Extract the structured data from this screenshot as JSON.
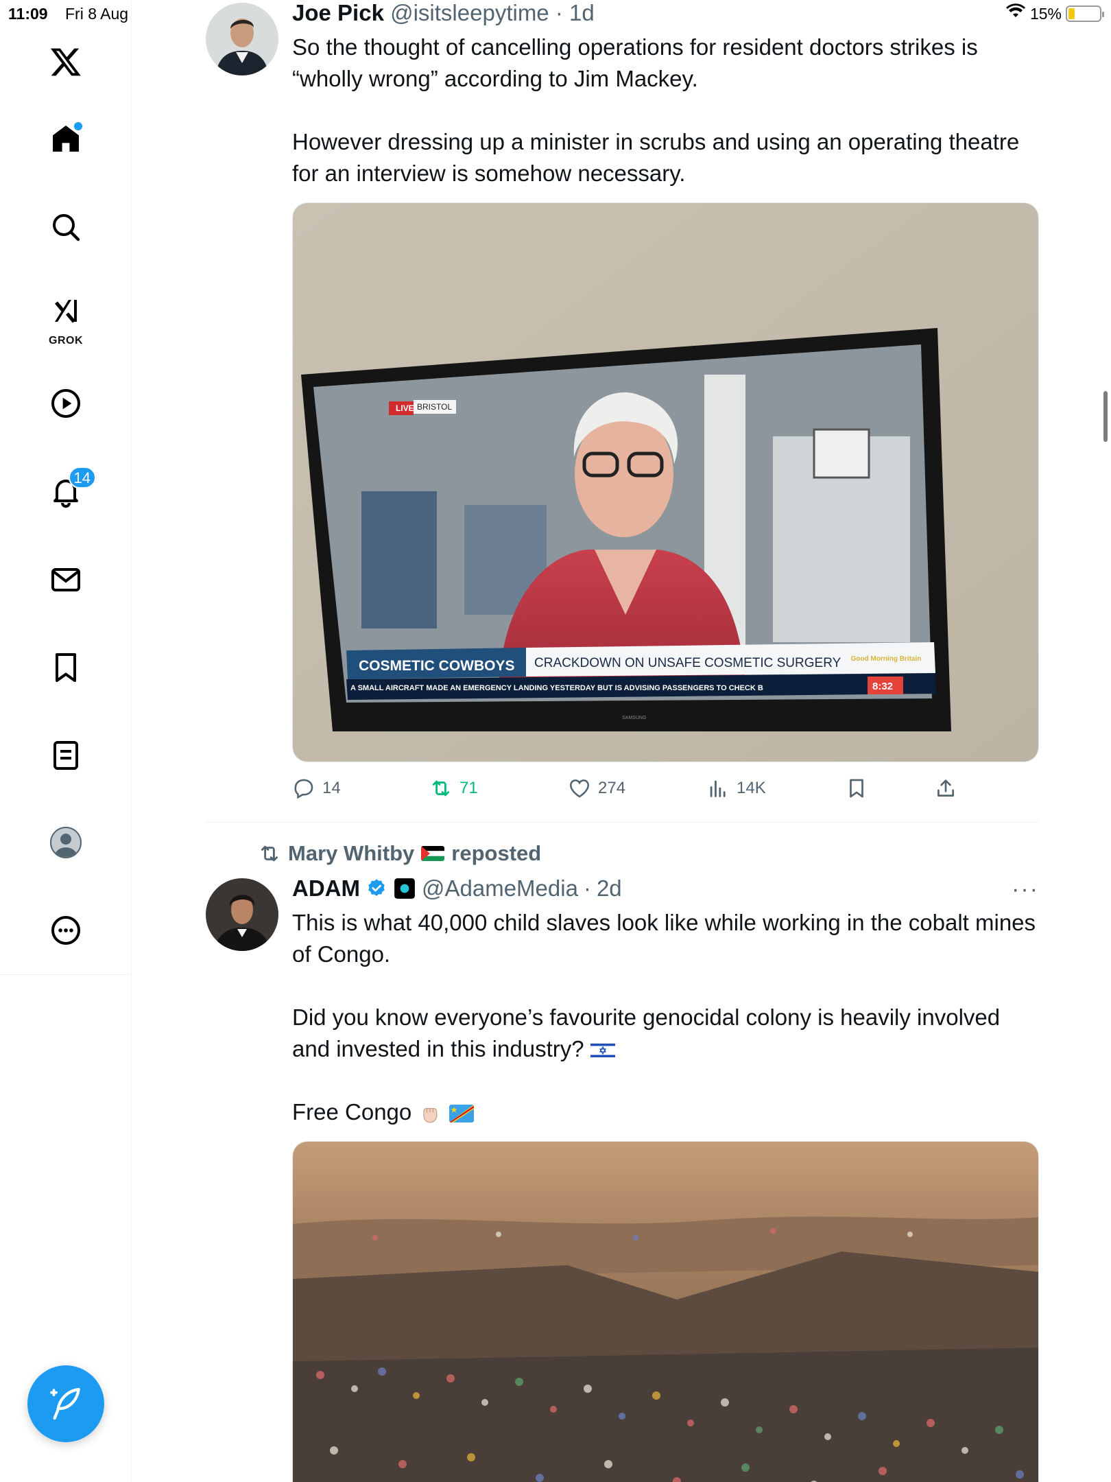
{
  "status_bar": {
    "time": "11:09",
    "date": "Fri 8 Aug",
    "battery": "15%",
    "battery_level": 0.15
  },
  "sidebar": {
    "grok_label": "GROK",
    "notifications_badge": "14"
  },
  "posts": [
    {
      "name": "Joe Pick",
      "handle": "@isitsleepytime",
      "sep": " · ",
      "time": "1d",
      "text": [
        "So the thought of cancelling operations for resident doctors strikes is “wholly wrong” according to Jim Mackey.",
        "However dressing up a minister in scrubs and using an operating theatre for an interview is somehow necessary."
      ],
      "media_text": {
        "live": "LIVE",
        "location": "BRISTOL",
        "headline_left": "COSMETIC COWBOYS",
        "headline_right": "CRACKDOWN ON UNSAFE COSMETIC SURGERY",
        "ticker": "A SMALL AIRCRAFT MADE AN EMERGENCY LANDING YESTERDAY BUT IS ADVISING PASSENGERS TO CHECK B",
        "clock": "8:32",
        "brand": "Good Morning Britain",
        "tv_brand": "SAMSUNG"
      },
      "stats": {
        "replies": "14",
        "reposts": "71",
        "likes": "274",
        "views": "14K"
      },
      "colors": {
        "repost_active": "#00ba7c"
      }
    },
    {
      "reposted_by": "Mary Whitby",
      "reposted_label": "reposted",
      "name": "ADAM",
      "handle": "@AdameMedia",
      "sep": " · ",
      "time": "2d",
      "more": "···",
      "text": [
        "This is what 40,000 child slaves look like while working in the cobalt mines of Congo.",
        "Did you know everyone’s favourite genocidal colony is heavily involved and invested in this industry?",
        "Free Congo"
      ]
    }
  ],
  "colors": {
    "accent": "#1d9bf0",
    "text": "#0f1419",
    "muted": "#536471"
  }
}
